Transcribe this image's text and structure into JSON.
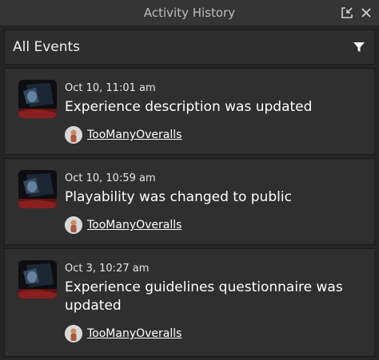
{
  "window": {
    "title": "Activity History"
  },
  "filter": {
    "label": "All Events"
  },
  "events": [
    {
      "time": "Oct 10, 11:01 am",
      "description": "Experience description was updated",
      "user": "TooManyOveralls"
    },
    {
      "time": "Oct 10, 10:59 am",
      "description": "Playability was changed to public",
      "user": "TooManyOveralls"
    },
    {
      "time": "Oct 3, 10:27 am",
      "description": "Experience guidelines questionnaire was updated",
      "user": "TooManyOveralls"
    }
  ],
  "icons": {
    "restore": "restore-window-icon",
    "close": "close-icon",
    "filter": "filter-funnel-icon",
    "thumbnail": "experience-thumbnail",
    "avatar": "user-avatar"
  },
  "colors": {
    "background": "#252525",
    "titlebar": "#353535",
    "card": "#2f2f2f",
    "text": "#ffffff",
    "muted": "#bdbdbd"
  }
}
